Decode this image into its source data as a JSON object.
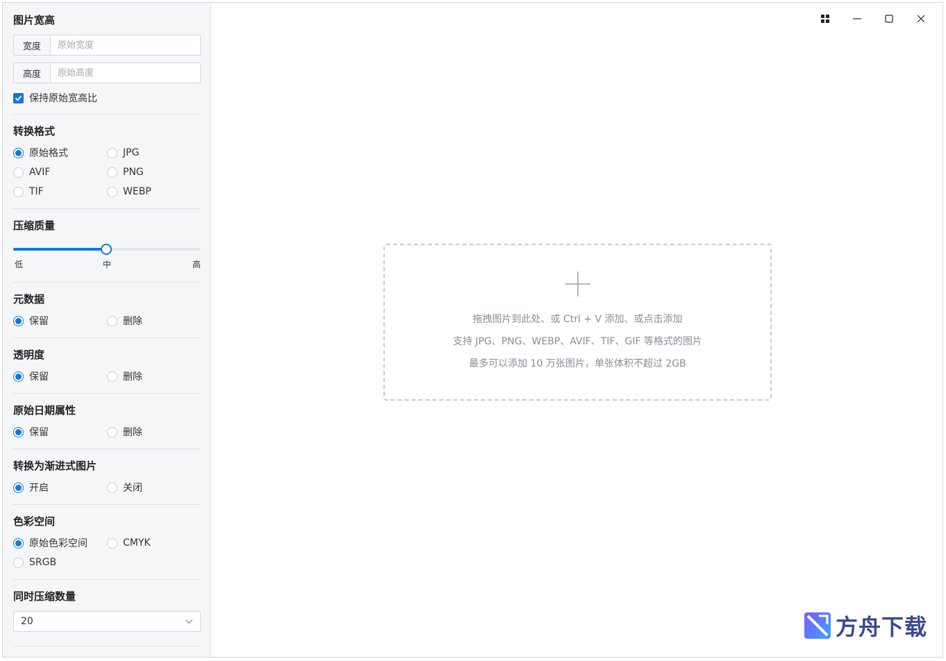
{
  "sidebar": {
    "size": {
      "title": "图片宽高",
      "width_label": "宽度",
      "width_placeholder": "原始宽度",
      "height_label": "高度",
      "height_placeholder": "原始高度",
      "keep_ratio_label": "保持原始宽高比",
      "keep_ratio_checked": true
    },
    "format": {
      "title": "转换格式",
      "options": [
        "原始格式",
        "JPG",
        "AVIF",
        "PNG",
        "TIF",
        "WEBP"
      ],
      "selected": "原始格式"
    },
    "quality": {
      "title": "压缩质量",
      "low": "低",
      "mid": "中",
      "high": "高",
      "level_fraction": 0.5
    },
    "metadata": {
      "title": "元数据",
      "options": [
        "保留",
        "删除"
      ],
      "selected": "保留"
    },
    "transparency": {
      "title": "透明度",
      "options": [
        "保留",
        "删除"
      ],
      "selected": "保留"
    },
    "date_attr": {
      "title": "原始日期属性",
      "options": [
        "保留",
        "删除"
      ],
      "selected": "保留"
    },
    "progressive": {
      "title": "转换为渐进式图片",
      "options": [
        "开启",
        "关闭"
      ],
      "selected": "开启"
    },
    "colorspace": {
      "title": "色彩空间",
      "options": [
        "原始色彩空间",
        "CMYK",
        "SRGB"
      ],
      "selected": "原始色彩空间"
    },
    "concurrency": {
      "title": "同时压缩数量",
      "value": "20"
    }
  },
  "dropzone": {
    "line1": "拖拽图片到此处、或 Ctrl + V 添加、或点击添加",
    "line2": "支持 JPG、PNG、WEBP、AVIF、TIF、GIF 等格式的图片",
    "line3": "最多可以添加 10 万张图片，单张体积不超过 2GB"
  },
  "watermark": {
    "text": "方舟下载"
  },
  "colors": {
    "accent": "#1976d2",
    "sidebar_bg": "#f5f6f8",
    "muted_text": "#8a8d93"
  },
  "icons": {
    "titlebar": [
      "grid-icon",
      "minimize-icon",
      "maximize-icon",
      "close-icon"
    ],
    "dropzone": "plus-icon",
    "select": "chevron-down-icon"
  }
}
